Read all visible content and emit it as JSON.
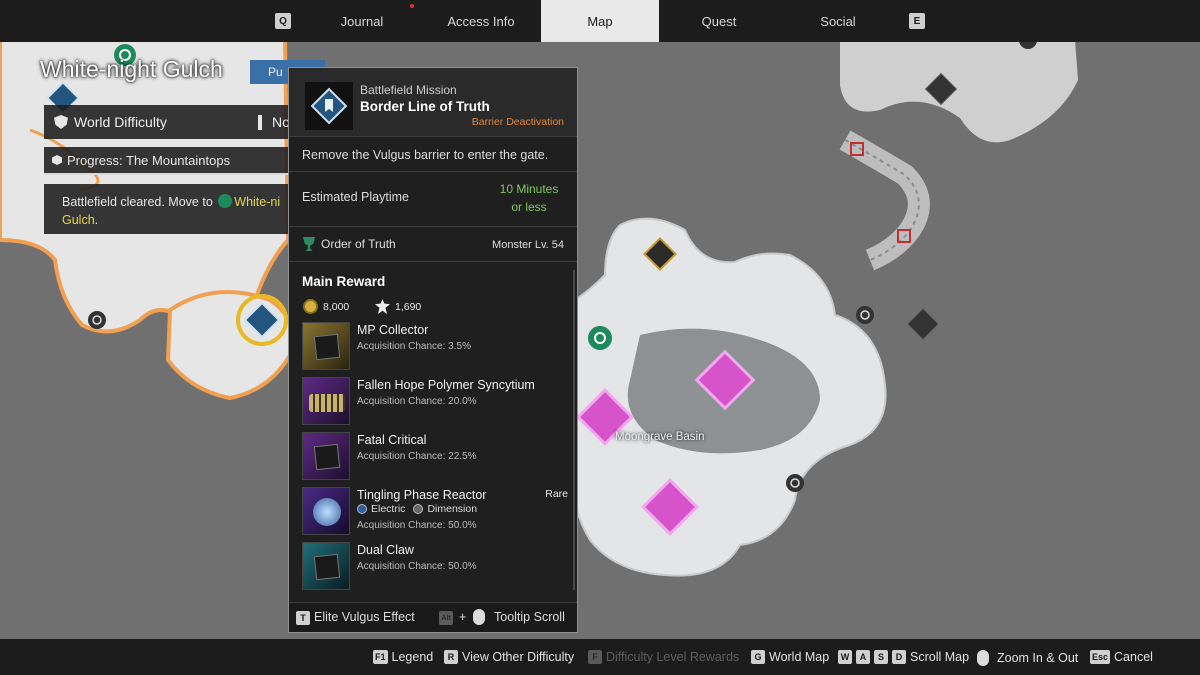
{
  "nav": {
    "left_key": "Q",
    "right_key": "E",
    "tabs": [
      {
        "label": "Journal"
      },
      {
        "label": "Access Info"
      },
      {
        "label": "Map"
      },
      {
        "label": "Quest"
      },
      {
        "label": "Social"
      }
    ],
    "active_tab": "Map"
  },
  "zone": {
    "title": "White-night Gulch",
    "pill": "Pu"
  },
  "world_difficulty": {
    "label": "World Difficulty",
    "value": "No"
  },
  "progress": {
    "label": "Progress: The Mountaintops"
  },
  "status": {
    "text": "Battlefield cleared. Move to",
    "location_a": "White-ni",
    "location_b": "Gulch",
    "suffix": "."
  },
  "tooltip": {
    "mission_type": "Battlefield Mission",
    "mission_name": "Border Line of Truth",
    "mission_sub": "Barrier Deactivation",
    "description": "Remove the Vulgus barrier to enter the gate.",
    "playtime_label": "Estimated Playtime",
    "playtime_value_1": "10 Minutes",
    "playtime_value_2": "or less",
    "faction": "Order of Truth",
    "monster_level": "Monster Lv. 54",
    "reward_title": "Main Reward",
    "gold": "8,000",
    "xp": "1,690",
    "items": [
      {
        "name": "MP Collector",
        "chance": "Acquisition Chance: 3.5%"
      },
      {
        "name": "Fallen Hope Polymer Syncytium",
        "chance": "Acquisition Chance: 20.0%"
      },
      {
        "name": "Fatal Critical",
        "chance": "Acquisition Chance: 22.5%"
      },
      {
        "name": "Tingling Phase Reactor",
        "chance": "Acquisition Chance: 50.0%",
        "rarity": "Rare",
        "tag1": "Electric",
        "tag2": "Dimension"
      },
      {
        "name": "Dual Claw",
        "chance": "Acquisition Chance: 50.0%"
      }
    ],
    "footer_key": "T",
    "footer_left": "Elite Vulgus Effect",
    "footer_alt": "Alt",
    "footer_plus": "+",
    "footer_right": "Tooltip Scroll"
  },
  "map_label": "Moongrave Basin",
  "bottom_hints": [
    {
      "key": "F1",
      "label": "Legend"
    },
    {
      "key": "R",
      "label": "View Other Difficulty"
    },
    {
      "key": "F",
      "label": "Difficulty Level Rewards"
    },
    {
      "key": "G",
      "label": "World Map"
    },
    {
      "keys": [
        "W",
        "A",
        "S",
        "D"
      ],
      "label": "Scroll Map"
    },
    {
      "label": "Zoom In & Out"
    },
    {
      "key": "Esc",
      "label": "Cancel"
    }
  ],
  "colors": {
    "accent_green": "#7bc95a",
    "accent_orange": "#e0893a",
    "accent_yellow": "#e6d54a",
    "pink_marker": "#d653c9"
  },
  "icons": [
    "shield-icon",
    "progress-icon",
    "target-icon",
    "trophy-icon",
    "gold-coin-icon",
    "xp-icon",
    "mouse-icon",
    "pin-icon"
  ]
}
